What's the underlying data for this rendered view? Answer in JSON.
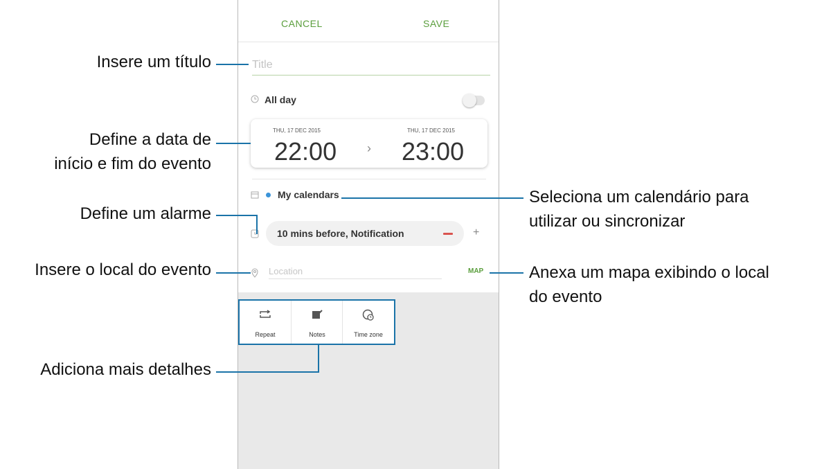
{
  "topbar": {
    "cancel": "CANCEL",
    "save": "SAVE"
  },
  "form": {
    "title_placeholder": "Title",
    "allday_label": "All day",
    "allday_on": false,
    "start_date": "THU, 17 DEC 2015",
    "start_time": "22:00",
    "end_date": "THU, 17 DEC 2015",
    "end_time": "23:00",
    "calendar_label": "My calendars",
    "calendar_color": "#3b94d9",
    "alarm_label": "10 mins before, Notification",
    "location_placeholder": "Location",
    "map_label": "MAP"
  },
  "details": [
    {
      "icon": "repeat-icon",
      "label": "Repeat"
    },
    {
      "icon": "notes-icon",
      "label": "Notes"
    },
    {
      "icon": "time-zone-icon",
      "label": "Time zone"
    }
  ],
  "callouts": {
    "title": "Insere um título",
    "date_1": "Define a data de",
    "date_2": "início e fim do evento",
    "alarm": "Define um alarme",
    "location": "Insere o local do evento",
    "details": "Adiciona mais detalhes",
    "calendar_1": "Seleciona um calendário para",
    "calendar_2": "utilizar ou sincronizar",
    "map_1": "Anexa um mapa exibindo o local",
    "map_2": "do evento"
  },
  "colors": {
    "accent": "#5a9e3c",
    "leader": "#1a73a8"
  }
}
